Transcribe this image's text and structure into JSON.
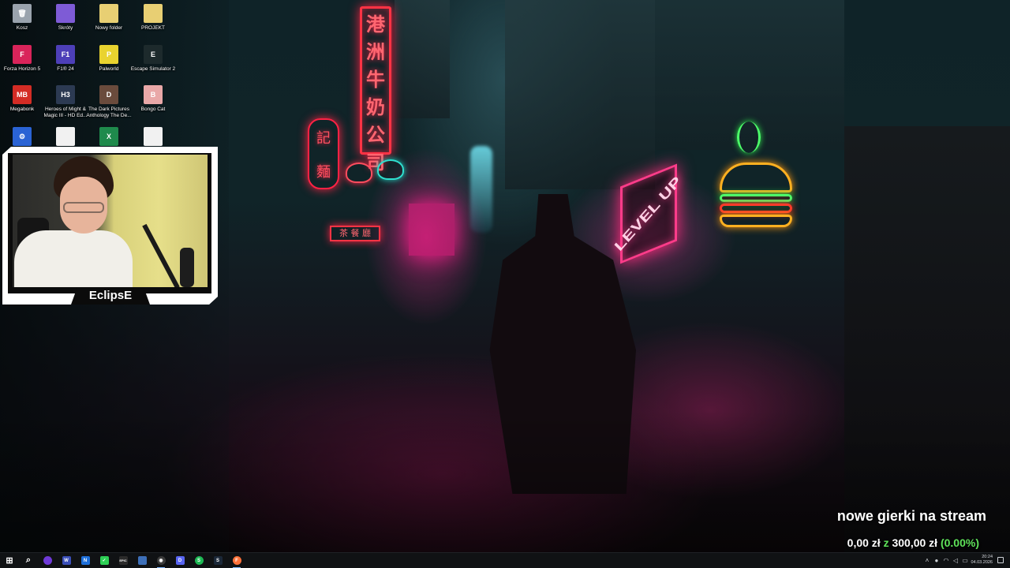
{
  "desktop": {
    "icons": [
      {
        "label": "Kosz",
        "icon": "recycle-bin-icon",
        "color": "#9aa3ad",
        "glyph": "🗑"
      },
      {
        "label": "Skróty",
        "icon": "folder-icon",
        "color": "#7e5bd6",
        "glyph": ""
      },
      {
        "label": "Nowy folder",
        "icon": "folder-icon",
        "color": "#e8cf73",
        "glyph": ""
      },
      {
        "label": "PROJEKT",
        "icon": "folder-icon",
        "color": "#e8cf73",
        "glyph": ""
      },
      {
        "label": "Forza Horizon 5",
        "icon": "game-icon",
        "color": "#d9245a",
        "glyph": "F"
      },
      {
        "label": "F1® 24",
        "icon": "game-icon",
        "color": "#4d3fb8",
        "glyph": "F1"
      },
      {
        "label": "Palworld",
        "icon": "game-icon",
        "color": "#e9d32f",
        "glyph": "P"
      },
      {
        "label": "Escape Simulator 2",
        "icon": "game-icon",
        "color": "#1d2a2c",
        "glyph": "E"
      },
      {
        "label": "Megabonk",
        "icon": "game-icon",
        "color": "#d42c25",
        "glyph": "MB"
      },
      {
        "label": "Heroes of Might & Magic III - HD Ed...",
        "icon": "game-icon",
        "color": "#2c3a52",
        "glyph": "H3"
      },
      {
        "label": "The Dark Pictures Anthology The De...",
        "icon": "game-icon",
        "color": "#6a4b3c",
        "glyph": "D"
      },
      {
        "label": "Bongo Cat",
        "icon": "game-icon",
        "color": "#e9a8a8",
        "glyph": "B"
      },
      {
        "label": "",
        "icon": "app-icon",
        "color": "#2a63d4",
        "glyph": "⚙"
      },
      {
        "label": "",
        "icon": "document-icon",
        "color": "#f1f1f1",
        "glyph": ""
      },
      {
        "label": "",
        "icon": "excel-icon",
        "color": "#1f8a4c",
        "glyph": "X"
      },
      {
        "label": "",
        "icon": "document-icon",
        "color": "#f1f1f1",
        "glyph": ""
      }
    ]
  },
  "webcam": {
    "name": "EclipsE"
  },
  "stream_goal": {
    "title": "nowe gierki na stream",
    "current": "0,00 zł",
    "separator": "z",
    "target": "300,00 zł",
    "percent": "(0.00%)",
    "accent_color": "#5fe35a"
  },
  "taskbar": {
    "items": [
      {
        "name": "start-button",
        "icon": "windows-icon",
        "color": "#ffffff",
        "glyph": "⊞",
        "active": false
      },
      {
        "name": "search-button",
        "icon": "search-icon",
        "color": "#ffffff",
        "glyph": "⌕",
        "active": false
      },
      {
        "name": "taskbar-app",
        "icon": "circle-app-icon",
        "color": "#6f3ad8",
        "glyph": "",
        "active": false
      },
      {
        "name": "taskbar-app",
        "icon": "app-icon",
        "color": "#3a4fb8",
        "glyph": "W",
        "active": false
      },
      {
        "name": "taskbar-app",
        "icon": "app-icon",
        "color": "#1e6fd9",
        "glyph": "N",
        "active": false
      },
      {
        "name": "taskbar-app",
        "icon": "app-icon",
        "color": "#2dcf55",
        "glyph": "✓",
        "active": false
      },
      {
        "name": "taskbar-app",
        "icon": "epic-games-icon",
        "color": "#2b2b2b",
        "glyph": "EPIC",
        "active": false
      },
      {
        "name": "taskbar-app",
        "icon": "app-icon",
        "color": "#3d6fb8",
        "glyph": "",
        "active": false
      },
      {
        "name": "taskbar-app",
        "icon": "obs-icon",
        "color": "#3a3a3a",
        "glyph": "◉",
        "active": true
      },
      {
        "name": "taskbar-app",
        "icon": "discord-icon",
        "color": "#5865f2",
        "glyph": "D",
        "active": false
      },
      {
        "name": "taskbar-app",
        "icon": "spotify-icon",
        "color": "#1db954",
        "glyph": "S",
        "active": false
      },
      {
        "name": "taskbar-app",
        "icon": "steam-icon",
        "color": "#1b2838",
        "glyph": "S",
        "active": false
      },
      {
        "name": "taskbar-app",
        "icon": "firefox-icon",
        "color": "#ff7139",
        "glyph": "F",
        "active": true
      }
    ],
    "tray": {
      "time": "20:24",
      "date": "04.03.2026"
    }
  }
}
